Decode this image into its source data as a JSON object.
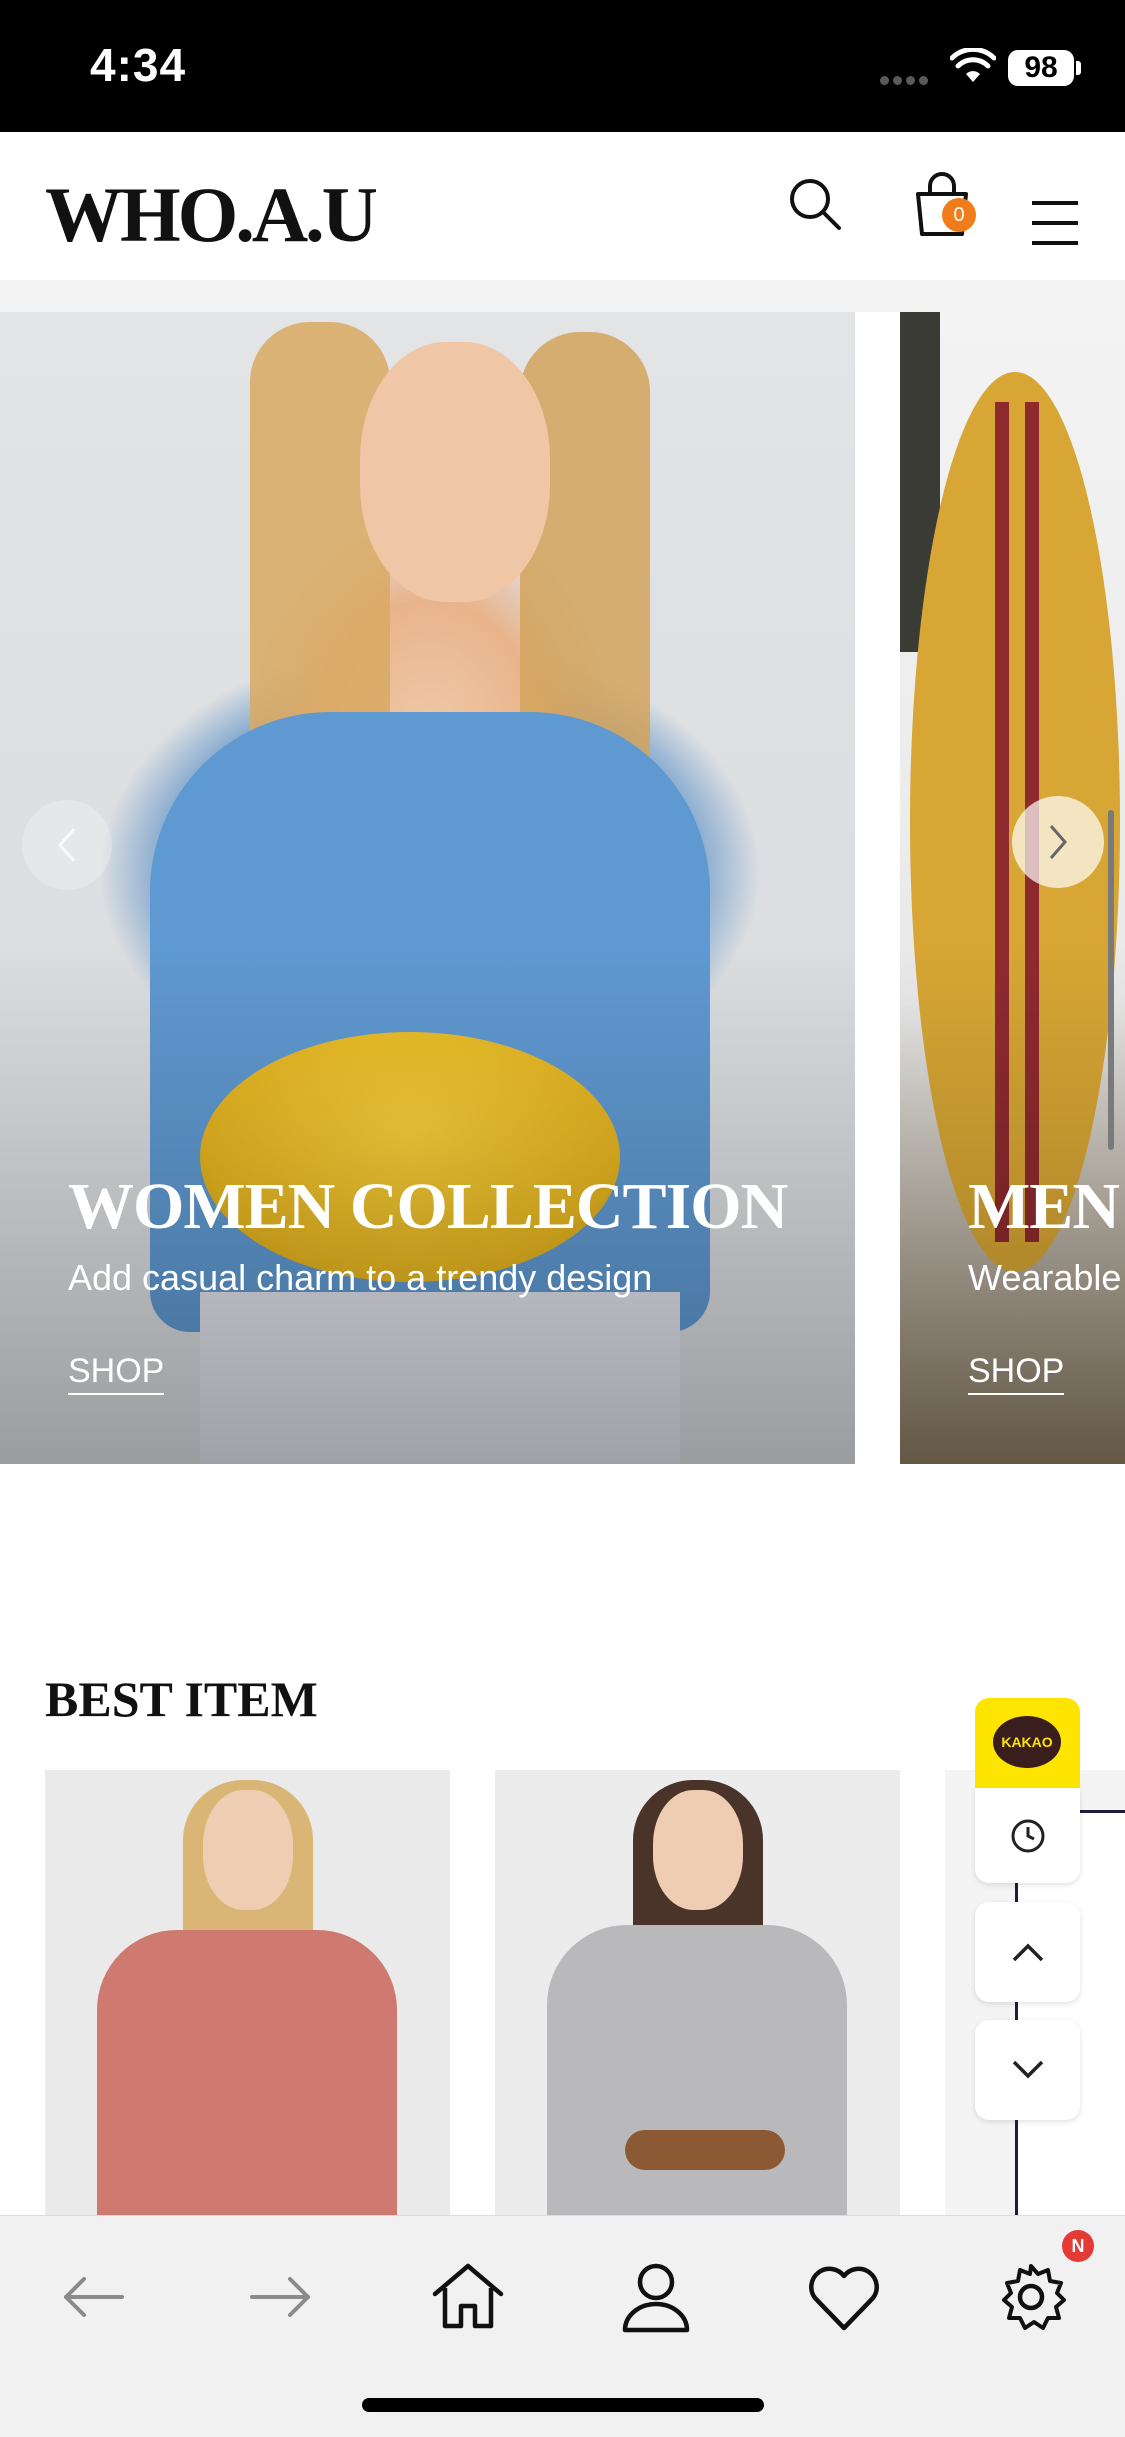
{
  "status_bar": {
    "time": "4:34",
    "battery": "98"
  },
  "header": {
    "logo": "WHO.A.U",
    "cart_count": "0"
  },
  "hero": {
    "slides": [
      {
        "title": "WOMEN COLLECTION",
        "subtitle": "Add casual charm to a trendy design",
        "cta": "SHOP"
      },
      {
        "title": "MEN",
        "subtitle": "Wearable",
        "cta": "SHOP"
      }
    ]
  },
  "best": {
    "title": "BEST ITEM"
  },
  "float": {
    "kakao_label": "KAKAO"
  },
  "bottom_nav": {
    "settings_badge": "N"
  },
  "colors": {
    "accent_orange": "#f07c1a",
    "kakao_yellow": "#fee500",
    "badge_red": "#e53935"
  }
}
